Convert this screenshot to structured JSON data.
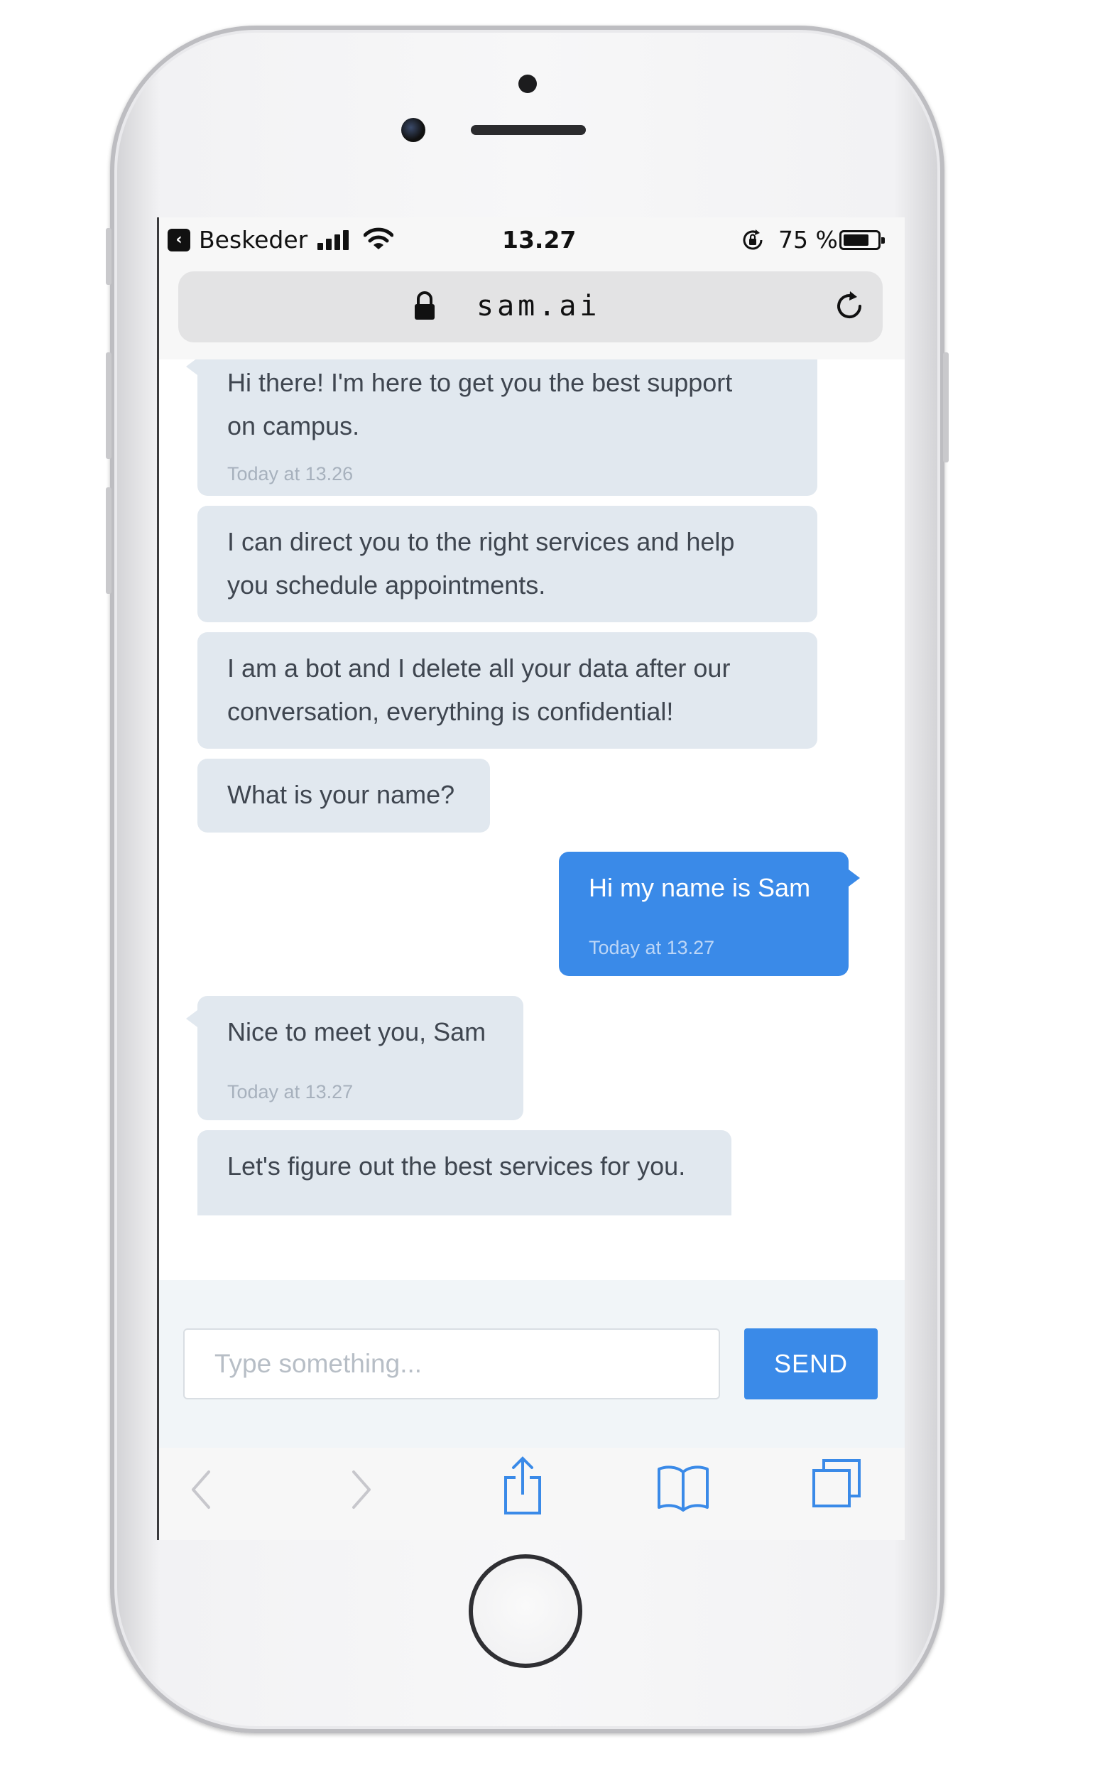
{
  "status_bar": {
    "back_app": "Beskeder",
    "time": "13.27",
    "battery_pct": "75 %",
    "battery_level": 0.75
  },
  "browser": {
    "url": "sam.ai"
  },
  "messages": [
    {
      "sender": "bot",
      "text_lines": [
        "Hi there! I'm here to get you the best support",
        "on campus."
      ],
      "timestamp": "Today at 13.26"
    },
    {
      "sender": "bot",
      "text_lines": [
        "I can direct you to the right services and help",
        "you schedule appointments."
      ]
    },
    {
      "sender": "bot",
      "text_lines": [
        "I am a bot and I delete all your data after our",
        "conversation, everything is confidential!"
      ]
    },
    {
      "sender": "bot",
      "text_lines": [
        "What is your name?"
      ]
    },
    {
      "sender": "user",
      "text_lines": [
        "Hi my name is Sam"
      ],
      "timestamp": "Today at 13.27"
    },
    {
      "sender": "bot",
      "text_lines": [
        "Nice to meet you, Sam"
      ],
      "timestamp": "Today at 13.27"
    },
    {
      "sender": "bot",
      "text_lines": [
        "Let's figure out the best services for you."
      ]
    }
  ],
  "composer": {
    "placeholder": "Type something...",
    "value": "",
    "send_label": "SEND"
  },
  "toolbar": {
    "icons": [
      "back-arrow-icon",
      "forward-arrow-icon",
      "share-icon",
      "bookmarks-icon",
      "tabs-icon"
    ]
  },
  "colors": {
    "bot_bubble": "#e1e8ef",
    "user_bubble": "#3a8ae8",
    "accent": "#3a8ae8",
    "toolbar_icon": "#3a8ae8",
    "toolbar_icon_disabled": "#c7c7cc"
  }
}
